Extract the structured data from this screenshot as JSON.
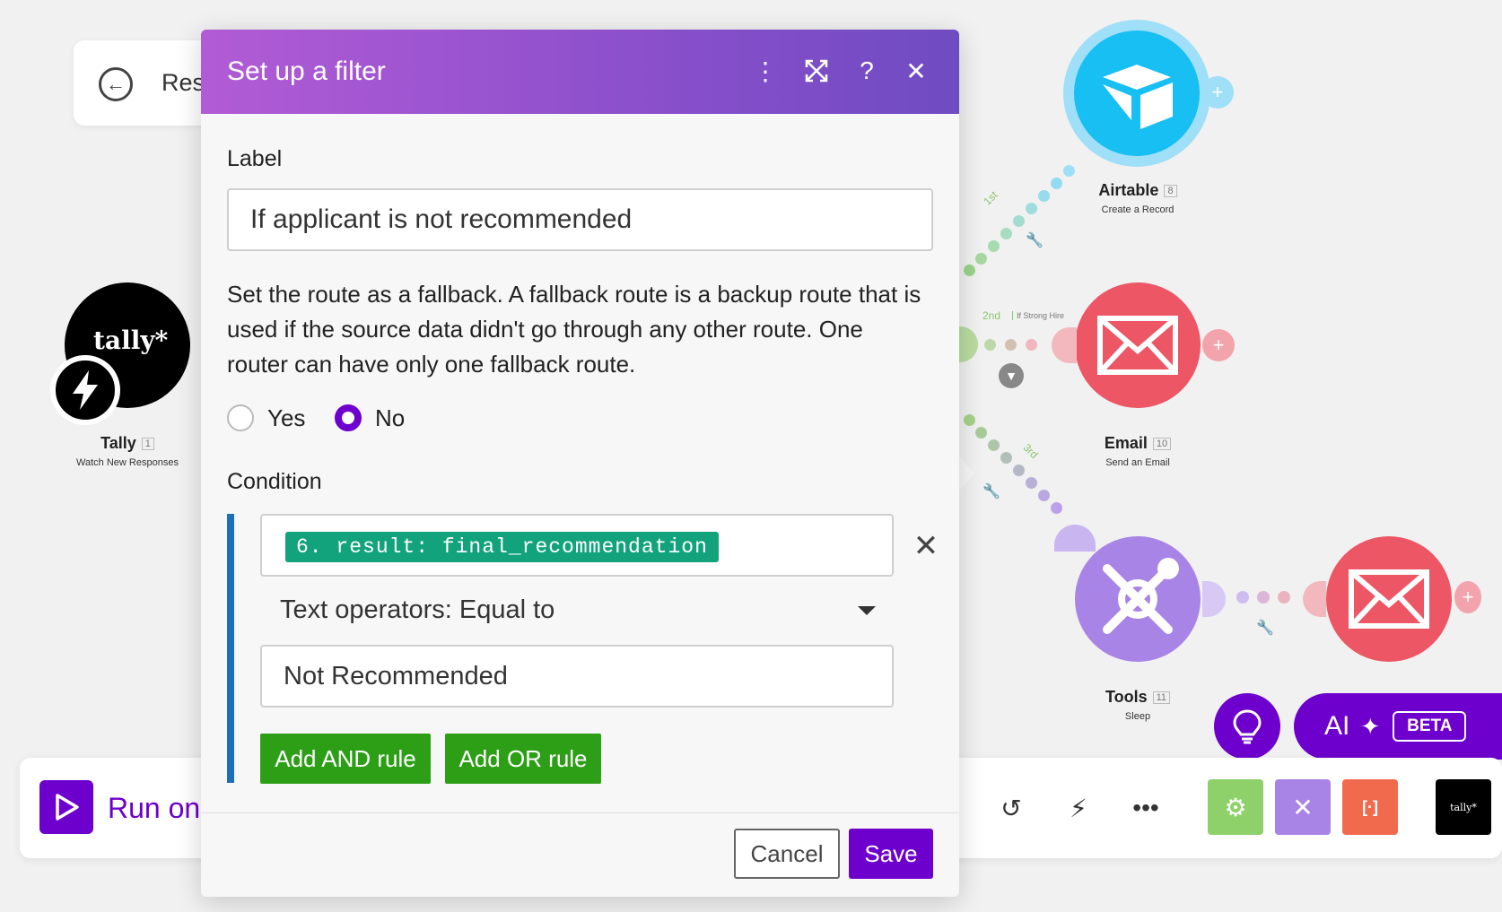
{
  "scenario": {
    "title_partial": "Res",
    "back_icon": "arrow-left-circle-icon"
  },
  "modal": {
    "title": "Set up a filter",
    "label_heading": "Label",
    "label_value": "If applicant is not recommended",
    "fallback_text": "Set the route as a fallback. A fallback route is a backup route that is used if the source data didn't go through any other route. One router can have only one fallback route.",
    "fallback_options": [
      {
        "label": "Yes",
        "checked": false
      },
      {
        "label": "No",
        "checked": true
      }
    ],
    "condition_heading": "Condition",
    "condition_field": "6. result: final_recommendation",
    "operator": "Text operators: Equal to",
    "condition_value": "Not Recommended",
    "add_and": "Add AND rule",
    "add_or": "Add OR rule",
    "cancel": "Cancel",
    "save": "Save",
    "remove_symbol": "✕"
  },
  "nodes": {
    "tally": {
      "title": "Tally",
      "num": "1",
      "sub": "Watch New Responses",
      "logo": "tally*"
    },
    "airtable": {
      "title": "Airtable",
      "num": "8",
      "sub": "Create a Record"
    },
    "email1": {
      "title": "Email",
      "num": "10",
      "sub": "Send an Email"
    },
    "tools": {
      "title": "Tools",
      "num": "11",
      "sub": "Sleep"
    }
  },
  "routes": {
    "first": "1st",
    "second": "2nd",
    "second_filter": "If Strong Hire",
    "third": "3rd"
  },
  "toolbar": {
    "run_label": "Run onc",
    "ai_label": "AI",
    "beta": "BETA",
    "tally_logo": "tally*"
  },
  "colors": {
    "brand_purple": "#6d00cc",
    "green": "#2d9f16",
    "pill": "#12a37c",
    "email_red": "#ec5665",
    "airtable_blue": "#18bff2",
    "tools_purple": "#a884e6"
  }
}
